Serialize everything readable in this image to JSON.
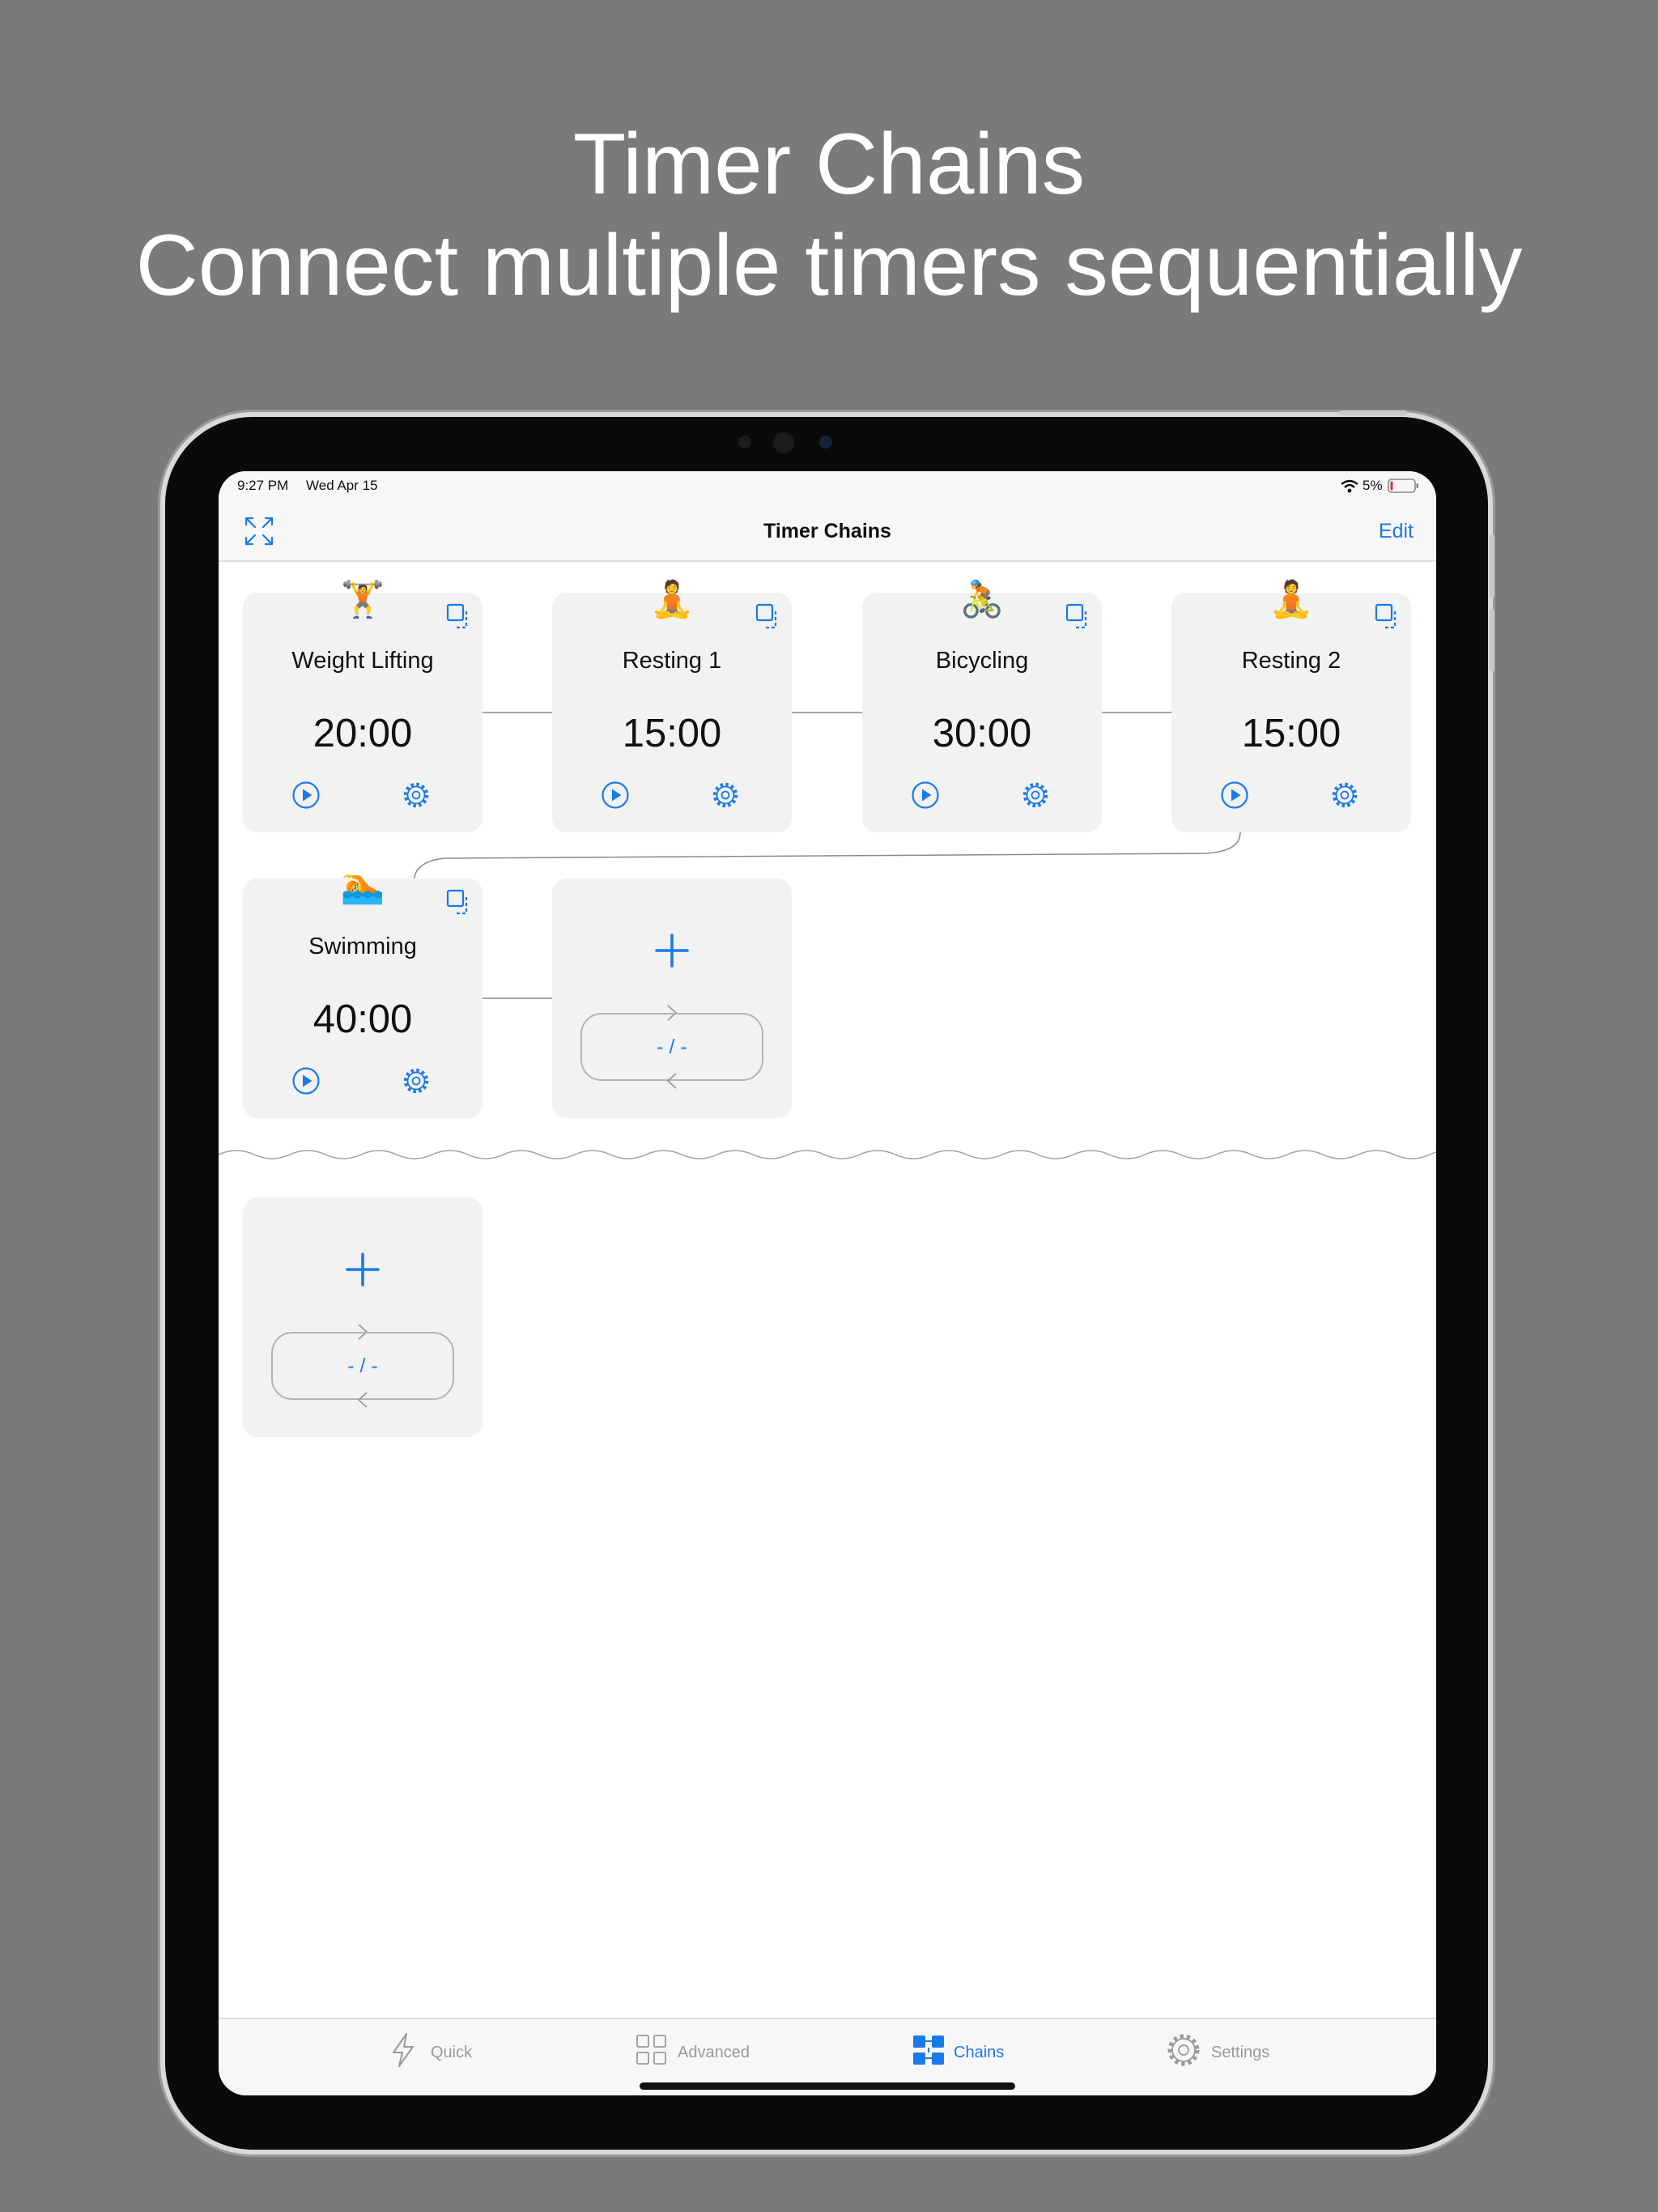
{
  "headline": {
    "line1": "Timer Chains",
    "line2": "Connect multiple timers sequentially"
  },
  "status_bar": {
    "time": "9:27 PM",
    "date": "Wed Apr 15",
    "battery": "5%"
  },
  "nav": {
    "title": "Timer Chains",
    "edit_label": "Edit"
  },
  "chain": {
    "timers": [
      {
        "emoji": "🏋️",
        "name": "Weight Lifting",
        "time": "20:00"
      },
      {
        "emoji": "🧘",
        "name": "Resting 1",
        "time": "15:00"
      },
      {
        "emoji": "🚴",
        "name": "Bicycling",
        "time": "30:00"
      },
      {
        "emoji": "🧘",
        "name": "Resting 2",
        "time": "15:00"
      },
      {
        "emoji": "🏊",
        "name": "Swimming",
        "time": "40:00"
      }
    ],
    "loop_count": "- / -"
  },
  "new_chain": {
    "loop_count": "- / -"
  },
  "tabbar": {
    "tabs": [
      {
        "label": "Quick",
        "icon": "bolt-icon",
        "active": false
      },
      {
        "label": "Advanced",
        "icon": "grid-icon",
        "active": false
      },
      {
        "label": "Chains",
        "icon": "chain-icon",
        "active": true
      },
      {
        "label": "Settings",
        "icon": "gear-icon",
        "active": false
      }
    ]
  },
  "colors": {
    "accent": "#1a7ae8",
    "background": "#7a7a7a",
    "card": "#f2f2f2",
    "inactive_tab": "#9a9a9a"
  }
}
